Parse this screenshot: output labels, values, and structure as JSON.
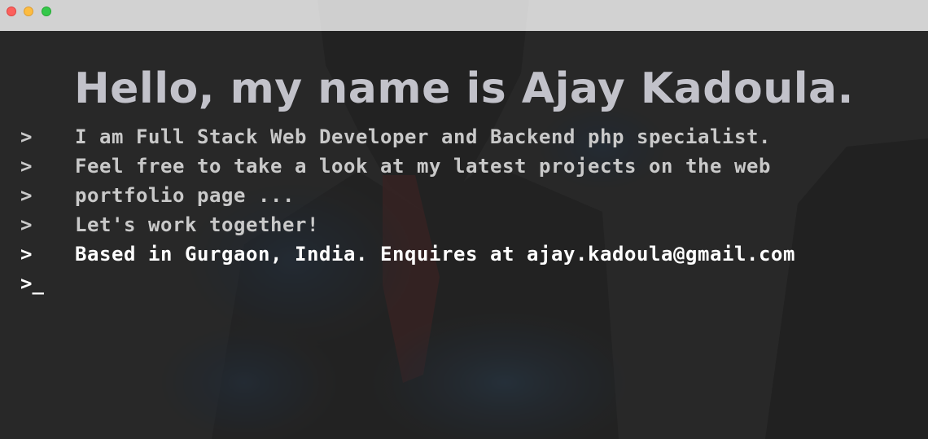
{
  "window": {
    "controls": [
      "close",
      "minimize",
      "maximize"
    ],
    "colors": {
      "close": "#fc605c",
      "minimize": "#fdbc40",
      "maximize": "#34c84a",
      "titlebar": "#dedede",
      "terminal_bg": "#2f2f2f"
    }
  },
  "headline": "Hello, my name is Ajay Kadoula.",
  "prompt_symbol": ">",
  "lines": [
    {
      "prompt": ">",
      "text": "I am Full Stack Web Developer and Backend php specialist."
    },
    {
      "prompt": ">",
      "text": "Feel free to take a look at my latest projects on the web"
    },
    {
      "prompt": ">",
      "text": "portfolio page ..."
    },
    {
      "prompt": ">",
      "text": "Let's work together!"
    },
    {
      "prompt": ">",
      "text": "Based in Gurgaon, India. Enquires at ajay.kadoula@gmail.com"
    }
  ],
  "cursor": {
    "prompt": ">",
    "caret": "_"
  }
}
